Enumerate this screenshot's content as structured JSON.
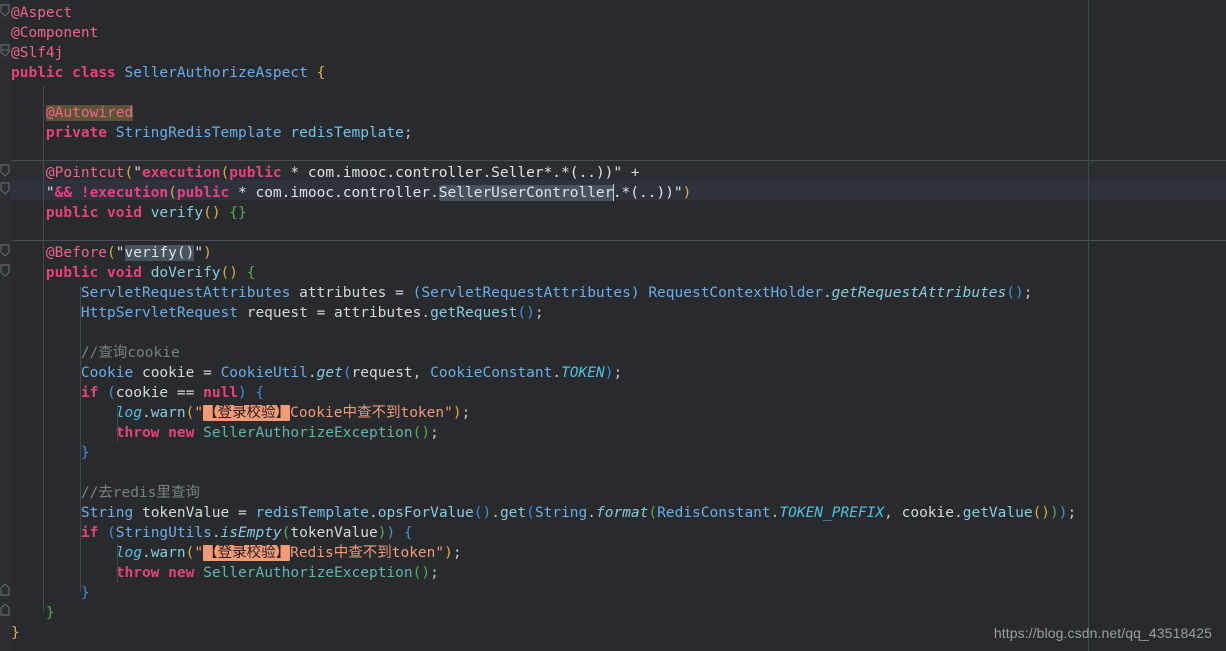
{
  "editor": {
    "name": "java-code-editor",
    "language": "Java",
    "theme": "dark",
    "colors": {
      "background": "#282a2e",
      "current_line": "#2f323b",
      "gutter": "#2b2d31",
      "keyword": "#e8417e",
      "annotation": "#f0648a",
      "type": "#6aaee8",
      "string": "#dfe1e4",
      "message_string": "#f09a76",
      "comment": "#7b8086",
      "constant": "#4fc1e0",
      "bracket_1": "#d9ad49",
      "bracket_2": "#56a955",
      "bracket_3": "#3f8fd6",
      "selection": "#49525f",
      "identifier_highlight": "#5d5438",
      "margin_guide": "#43464d",
      "watermark": "#9a9ea4"
    }
  },
  "watermark": {
    "text": "https://blog.csdn.net/qq_43518425"
  },
  "code": {
    "lines": [
      {
        "n": 1,
        "text": "@Aspect"
      },
      {
        "n": 2,
        "text": "@Component"
      },
      {
        "n": 3,
        "text": "@Slf4j"
      },
      {
        "n": 4,
        "text": "public class SellerAuthorizeAspect {"
      },
      {
        "n": 5,
        "text": ""
      },
      {
        "n": 6,
        "text": "    @Autowired"
      },
      {
        "n": 7,
        "text": "    private StringRedisTemplate redisTemplate;"
      },
      {
        "n": 8,
        "text": ""
      },
      {
        "n": 9,
        "text": "    @Pointcut(\"execution(public * com.imooc.controller.Seller*.*(..))\" +"
      },
      {
        "n": 10,
        "text": "    \"&& !execution(public * com.imooc.controller.SellerUserController.*(..))\")"
      },
      {
        "n": 11,
        "text": "    public void verify() {}"
      },
      {
        "n": 12,
        "text": ""
      },
      {
        "n": 13,
        "text": "    @Before(\"verify()\")"
      },
      {
        "n": 14,
        "text": "    public void doVerify() {"
      },
      {
        "n": 15,
        "text": "        ServletRequestAttributes attributes = (ServletRequestAttributes) RequestContextHolder.getRequestAttributes();"
      },
      {
        "n": 16,
        "text": "        HttpServletRequest request = attributes.getRequest();"
      },
      {
        "n": 17,
        "text": ""
      },
      {
        "n": 18,
        "text": "        //查询cookie"
      },
      {
        "n": 19,
        "text": "        Cookie cookie = CookieUtil.get(request, CookieConstant.TOKEN);"
      },
      {
        "n": 20,
        "text": "        if (cookie == null) {"
      },
      {
        "n": 21,
        "text": "            log.warn(\"【登录校验】Cookie中查不到token\");"
      },
      {
        "n": 22,
        "text": "            throw new SellerAuthorizeException();"
      },
      {
        "n": 23,
        "text": "        }"
      },
      {
        "n": 24,
        "text": ""
      },
      {
        "n": 25,
        "text": "        //去redis里查询"
      },
      {
        "n": 26,
        "text": "        String tokenValue = redisTemplate.opsForValue().get(String.format(RedisConstant.TOKEN_PREFIX, cookie.getValue()));"
      },
      {
        "n": 27,
        "text": "        if (StringUtils.isEmpty(tokenValue)) {"
      },
      {
        "n": 28,
        "text": "            log.warn(\"【登录校验】Redis中查不到token\");"
      },
      {
        "n": 29,
        "text": "            throw new SellerAuthorizeException();"
      },
      {
        "n": 30,
        "text": "        }"
      },
      {
        "n": 31,
        "text": "    }"
      },
      {
        "n": 32,
        "text": "}"
      }
    ],
    "highlights": {
      "identifier_occurrence": "@Autowired",
      "string_selection": "verify()",
      "caret_word": "SellerUserController",
      "message_selection": "【登录校验】"
    },
    "tokens": {
      "l1_anno": "@Aspect",
      "l2_anno": "@Component",
      "l3_anno": "@Slf4j",
      "l4_public": "public",
      "l4_class": "class",
      "l4_name": "SellerAuthorizeAspect",
      "l4_brace": "{",
      "l6_anno": "@Autowired",
      "l7_private": "private",
      "l7_type": "StringRedisTemplate",
      "l7_name": "redisTemplate",
      "l7_semi": ";",
      "l9_anno": "@Pointcut",
      "l9_open": "(",
      "l9_q1": "\"",
      "l9_exec": "execution",
      "l9_p1": "(",
      "l9_public": "public",
      "l9_rest": " * com.imooc.controller.Seller*.*(..))",
      "l9_q2": "\"",
      "l9_plus": "+",
      "l10_q1": "\"",
      "l10_amp": "&& !",
      "l10_exec": "execution",
      "l10_p1": "(",
      "l10_public": "public",
      "l10_mid": " * com.imooc.controller.",
      "l10_sel": "SellerUserController",
      "l10_rest": ".*(..))",
      "l10_q2": "\"",
      "l10_close": ")",
      "l11_public": "public",
      "l11_void": "void",
      "l11_name": "verify",
      "l11_parens": "()",
      "l11_body": "{}",
      "l13_anno": "@Before",
      "l13_open": "(",
      "l13_q1": "\"",
      "l13_sel": "verify()",
      "l13_q2": "\"",
      "l13_close": ")",
      "l14_public": "public",
      "l14_void": "void",
      "l14_name": "doVerify",
      "l14_parens": "()",
      "l14_brace": "{",
      "l15_type1": "ServletRequestAttributes",
      "l15_var": "attributes",
      "l15_eq": "=",
      "l15_cast": "(ServletRequestAttributes)",
      "l15_holder": "RequestContextHolder",
      "l15_dot": ".",
      "l15_call": "getRequestAttributes",
      "l15_parens": "()",
      "l15_semi": ";",
      "l16_type": "HttpServletRequest",
      "l16_var": "request",
      "l16_eq": "=",
      "l16_src": "attributes",
      "l16_call": "getRequest",
      "l16_parens": "()",
      "l16_semi": ";",
      "l18_comment": "//查询cookie",
      "l19_type": "Cookie",
      "l19_var": "cookie",
      "l19_eq": "=",
      "l19_util": "CookieUtil",
      "l19_get": "get",
      "l19_arg1": "request",
      "l19_const_cls": "CookieConstant",
      "l19_const": "TOKEN",
      "l19_semi": ";",
      "l20_if": "if",
      "l20_cookie": "cookie",
      "l20_op": "==",
      "l20_null": "null",
      "l20_brace": "{",
      "l21_log": "log",
      "l21_warn": "warn",
      "l21_str_hl": "【登录校验】",
      "l21_str_rest": "Cookie中查不到token",
      "l21_semi": ";",
      "l22_throw": "throw",
      "l22_new": "new",
      "l22_ex": "SellerAuthorizeException",
      "l22_parens": "()",
      "l22_semi": ";",
      "l23_brace": "}",
      "l25_comment": "//去redis里查询",
      "l26_type": "String",
      "l26_var": "tokenValue",
      "l26_eq": "=",
      "l26_tmpl": "redisTemplate",
      "l26_ops": "opsForValue",
      "l26_get": "get",
      "l26_string": "String",
      "l26_format": "format",
      "l26_rconst": "RedisConstant",
      "l26_prefix": "TOKEN_PREFIX",
      "l26_cookie": "cookie",
      "l26_getval": "getValue",
      "l26_semi": ";",
      "l27_if": "if",
      "l27_utils": "StringUtils",
      "l27_isempty": "isEmpty",
      "l27_arg": "tokenValue",
      "l27_brace": "{",
      "l28_log": "log",
      "l28_warn": "warn",
      "l28_str_hl": "【登录校验】",
      "l28_str_rest": "Redis中查不到token",
      "l28_semi": ";",
      "l29_throw": "throw",
      "l29_new": "new",
      "l29_ex": "SellerAuthorizeException",
      "l29_parens": "()",
      "l29_semi": ";",
      "l30_brace": "}",
      "l31_brace": "}",
      "l32_brace": "}"
    }
  }
}
